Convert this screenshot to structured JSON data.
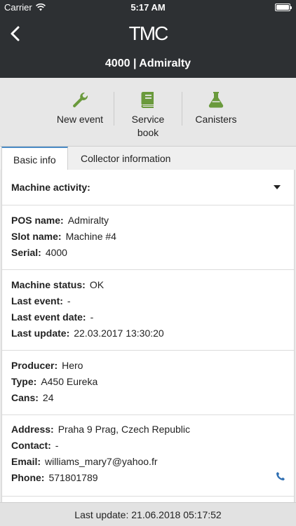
{
  "status_bar": {
    "carrier": "Carrier",
    "time": "5:17 AM"
  },
  "header": {
    "logo": "TMC",
    "title": "4000 | Admiralty"
  },
  "actions": [
    {
      "label": "New event",
      "icon": "wrench-icon"
    },
    {
      "label": "Service book",
      "icon": "book-icon"
    },
    {
      "label": "Canisters",
      "icon": "flask-icon"
    }
  ],
  "tabs": {
    "active": "Basic info",
    "inactive": "Collector information"
  },
  "activity": {
    "label": "Machine activity:"
  },
  "pos": {
    "pos_name_label": "POS name:",
    "pos_name": "Admiralty",
    "slot_name_label": "Slot name:",
    "slot_name": "Machine #4",
    "serial_label": "Serial:",
    "serial": "4000"
  },
  "status": {
    "machine_status_label": "Machine status:",
    "machine_status": "OK",
    "last_event_label": "Last event:",
    "last_event": "-",
    "last_event_date_label": "Last event date:",
    "last_event_date": "-",
    "last_update_label": "Last update:",
    "last_update": "22.03.2017 13:30:20"
  },
  "producer": {
    "producer_label": "Producer:",
    "producer": "Hero",
    "type_label": "Type:",
    "type": "A450 Eureka",
    "cans_label": "Cans:",
    "cans": "24"
  },
  "contact": {
    "address_label": "Address:",
    "address": "Praha 9 Prag, Czech Republic",
    "contact_label": "Contact:",
    "contact": "-",
    "email_label": "Email:",
    "email": "williams_mary7@yahoo.fr",
    "phone_label": "Phone:",
    "phone": "571801789"
  },
  "footer": {
    "text": "Last update: 21.06.2018 05:17:52"
  },
  "colors": {
    "header_bg": "#2d3033",
    "accent_green": "#6a9a3c",
    "tab_accent": "#4a8ac4",
    "phone_blue": "#2f6fb2"
  }
}
